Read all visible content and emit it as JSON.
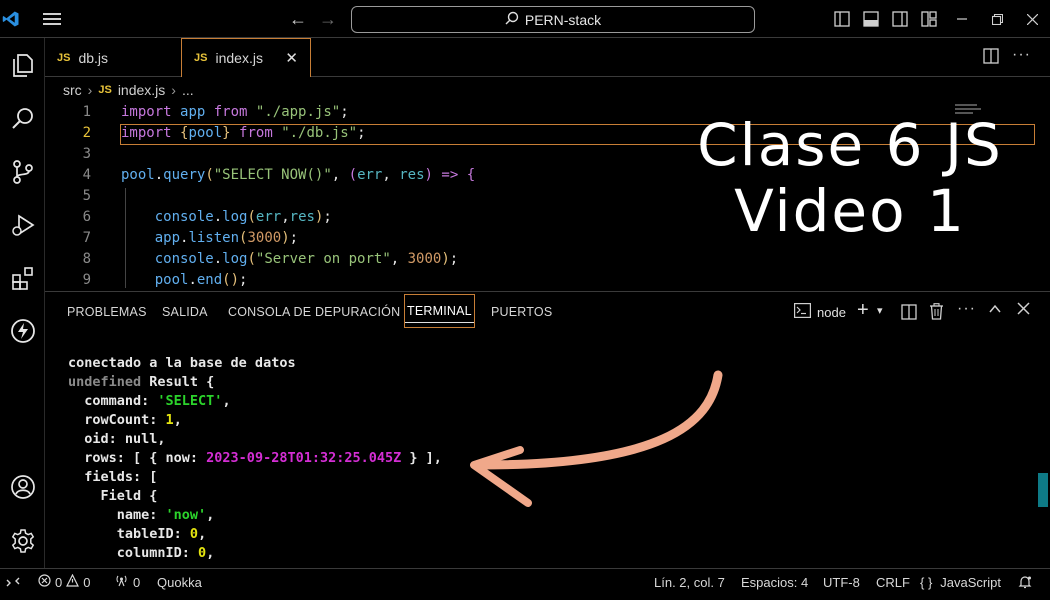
{
  "titlebar": {
    "search_text": "PERN-stack"
  },
  "tabs": [
    {
      "label": "db.js",
      "badge": "JS"
    },
    {
      "label": "index.js",
      "badge": "JS"
    }
  ],
  "breadcrumb": {
    "folder": "src",
    "badge": "JS",
    "file": "index.js",
    "more": "..."
  },
  "editor": {
    "line_numbers": [
      "1",
      "2",
      "3",
      "4",
      "5",
      "6",
      "7",
      "8",
      "9"
    ]
  },
  "overlay": {
    "line1": "Clase 6 JS",
    "line2": "Video 1"
  },
  "panel": {
    "tabs": [
      "PROBLEMAS",
      "SALIDA",
      "CONSOLA DE DEPURACIÓN",
      "TERMINAL",
      "PUERTOS"
    ],
    "shell": "node"
  },
  "terminal": {
    "line1": "conectado a la base de datos",
    "line2_a": "undefined",
    "line2_b": " Result {",
    "line3_a": "  command: ",
    "line3_b": "'SELECT'",
    "line3_c": ",",
    "line4_a": "  rowCount: ",
    "line4_b": "1",
    "line4_c": ",",
    "line5": "  oid: null,",
    "line6_a": "  rows: [ { now: ",
    "line6_b": "2023-09-28T01:32:25.045Z",
    "line6_c": " } ],",
    "line7": "  fields: [",
    "line8": "    Field {",
    "line9_a": "      name: ",
    "line9_b": "'now'",
    "line9_c": ",",
    "line10_a": "      tableID: ",
    "line10_b": "0",
    "line10_c": ",",
    "line11_a": "      columnID: ",
    "line11_b": "0",
    "line11_c": ","
  },
  "statusbar": {
    "errors": "0",
    "warnings": "0",
    "ports": "0",
    "quokka": "Quokka",
    "position": "Lín. 2, col. 7",
    "spaces": "Espacios: 4",
    "encoding": "UTF-8",
    "eol": "CRLF",
    "language": "JavaScript",
    "language_icon": "{ }"
  },
  "colors": {
    "accent": "#c77e36",
    "js_badge": "#e8c33a",
    "terminal_green": "#2bd32b",
    "terminal_magenta": "#d42ed4",
    "terminal_yellow": "#e5e510",
    "arrow": "#f0a88a"
  }
}
